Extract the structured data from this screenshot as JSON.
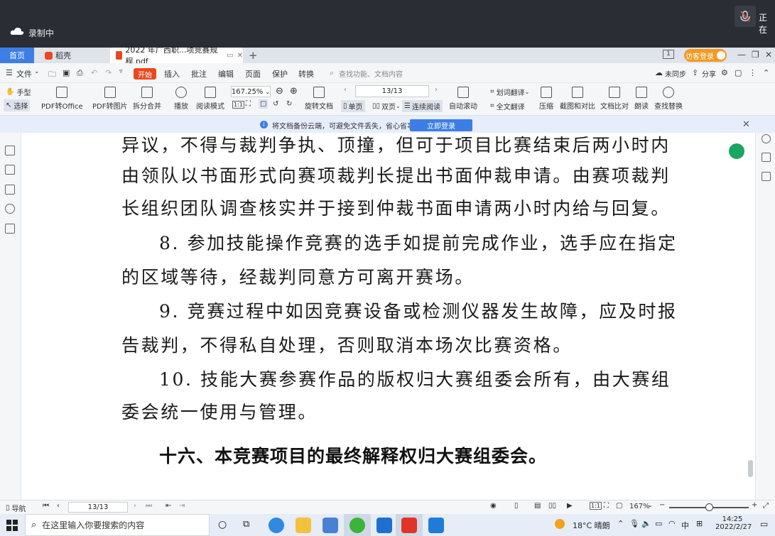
{
  "recorder": {
    "label": "录制中",
    "status_right": "正在"
  },
  "tabs": {
    "home": "首页",
    "daoke": "稻壳",
    "doc": "2022 年广西职...项竞赛规程.pdf",
    "add": "+",
    "login": "访客登录"
  },
  "menu": {
    "file": "文件",
    "start": "开始",
    "insert": "插入",
    "annotate": "批注",
    "edit": "编辑",
    "page": "页面",
    "protect": "保护",
    "convert": "转换",
    "search_placeholder": "查找功能、文档内容",
    "sync": "未同步",
    "share": "分享"
  },
  "toolbar": {
    "hand": "手型",
    "select": "选择",
    "pdf_to_office": "PDF转Office",
    "pdf_to_image": "PDF转图片",
    "split_merge": "拆分合并",
    "play": "播放",
    "read_mode": "阅读模式",
    "zoom": "167.25%",
    "rotate": "旋转文档",
    "page_indicator": "13/13",
    "single": "单页",
    "double": "双页",
    "continuous": "连续阅读",
    "auto_scroll": "自动滚动",
    "word_translate": "划词翻译",
    "full_translate": "全文翻译",
    "compress": "压缩",
    "screenshot_compare": "截图和对比",
    "doc_compare": "文档比对",
    "read_aloud": "朗读",
    "find_replace": "查找替换"
  },
  "notice": {
    "text": "将文档备份云端，可避免文件丢失，省心省事",
    "button": "立即登录"
  },
  "document": {
    "lines": [
      "异议，不得与裁判争执、顶撞，但可于项目比赛结束后两小时内",
      "由领队以书面形式向赛项裁判长提出书面仲裁申请。由赛项裁判",
      "长组织团队调查核实并于接到仲裁书面申请两小时内给与回复。",
      "8. 参加技能操作竞赛的选手如提前完成作业，选手应在指定",
      "的区域等待，经裁判同意方可离开赛场。",
      "9. 竞赛过程中如因竞赛设备或检测仪器发生故障，应及时报",
      "告裁判，不得私自处理，否则取消本场次比赛资格。",
      "10. 技能大赛参赛作品的版权归大赛组委会所有，由大赛组",
      "委会统一使用与管理。"
    ],
    "heading": "十六、本竞赛项目的最终解释权归大赛组委会。"
  },
  "status": {
    "nav": "导航",
    "page": "13/13",
    "zoom": "167%"
  },
  "taskbar": {
    "search_placeholder": "在这里输入你要搜索的内容",
    "weather": "18°C 晴朗",
    "ime": "中",
    "time": "14:25",
    "date": "2022/2/27"
  }
}
